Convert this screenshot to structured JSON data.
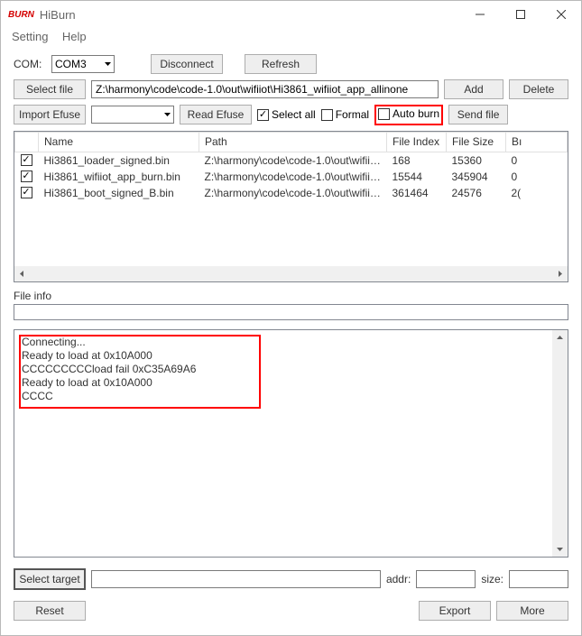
{
  "window": {
    "logo": "BURN",
    "title": "HiBurn"
  },
  "menu": {
    "setting": "Setting",
    "help": "Help"
  },
  "com": {
    "label": "COM:",
    "value": "COM3"
  },
  "actions": {
    "disconnect": "Disconnect",
    "refresh": "Refresh",
    "select_file": "Select file",
    "add": "Add",
    "delete": "Delete",
    "import_efuse": "Import Efuse",
    "read_efuse": "Read Efuse",
    "send_file": "Send file",
    "select_target": "Select target",
    "reset": "Reset",
    "export": "Export",
    "more": "More"
  },
  "file_path": "Z:\\harmony\\code\\code-1.0\\out\\wifiiot\\Hi3861_wifiiot_app_allinone",
  "checks": {
    "select_all": "Select all",
    "formal": "Formal",
    "auto_burn": "Auto burn"
  },
  "table": {
    "headers": {
      "name": "Name",
      "path": "Path",
      "file_index": "File Index",
      "file_size": "File Size",
      "b": "Bı"
    },
    "rows": [
      {
        "name": "Hi3861_loader_signed.bin",
        "path": "Z:\\harmony\\code\\code-1.0\\out\\wifiio...",
        "idx": "168",
        "size": "15360",
        "b": "0"
      },
      {
        "name": "Hi3861_wifiiot_app_burn.bin",
        "path": "Z:\\harmony\\code\\code-1.0\\out\\wifiio...",
        "idx": "15544",
        "size": "345904",
        "b": "0"
      },
      {
        "name": "Hi3861_boot_signed_B.bin",
        "path": "Z:\\harmony\\code\\code-1.0\\out\\wifiio...",
        "idx": "361464",
        "size": "24576",
        "b": "2("
      }
    ]
  },
  "file_info_label": "File info",
  "log": [
    "Connecting...",
    "Ready to load at 0x10A000",
    "CCCCCCCCCload fail 0xC35A69A6",
    "Ready to load at 0x10A000",
    "CCCC"
  ],
  "bottom": {
    "addr": "addr:",
    "size": "size:"
  }
}
